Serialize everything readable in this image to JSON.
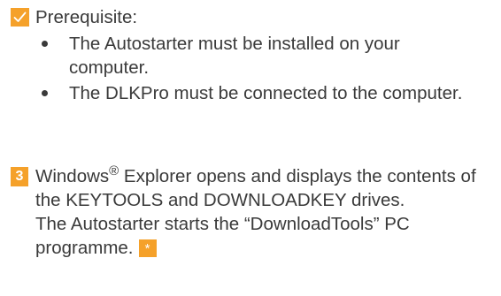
{
  "prerequisite": {
    "heading": "Prerequisite:",
    "icon": "checkmark-icon",
    "items": [
      "The Autostarter must be installed on your computer.",
      "The DLKPro must be connected to the computer."
    ]
  },
  "step": {
    "number": "3",
    "text_part1": "Windows",
    "registered_mark": "®",
    "text_part2": " Explorer opens and displays the contents of the KEYTOOLS and DOWNLOADKEY drives.",
    "text_line2": "The Autostarter starts the “DownloadTools” PC programme.",
    "note_marker": "*"
  },
  "colors": {
    "accent": "#f5a12a",
    "text": "#3a3a3a"
  }
}
